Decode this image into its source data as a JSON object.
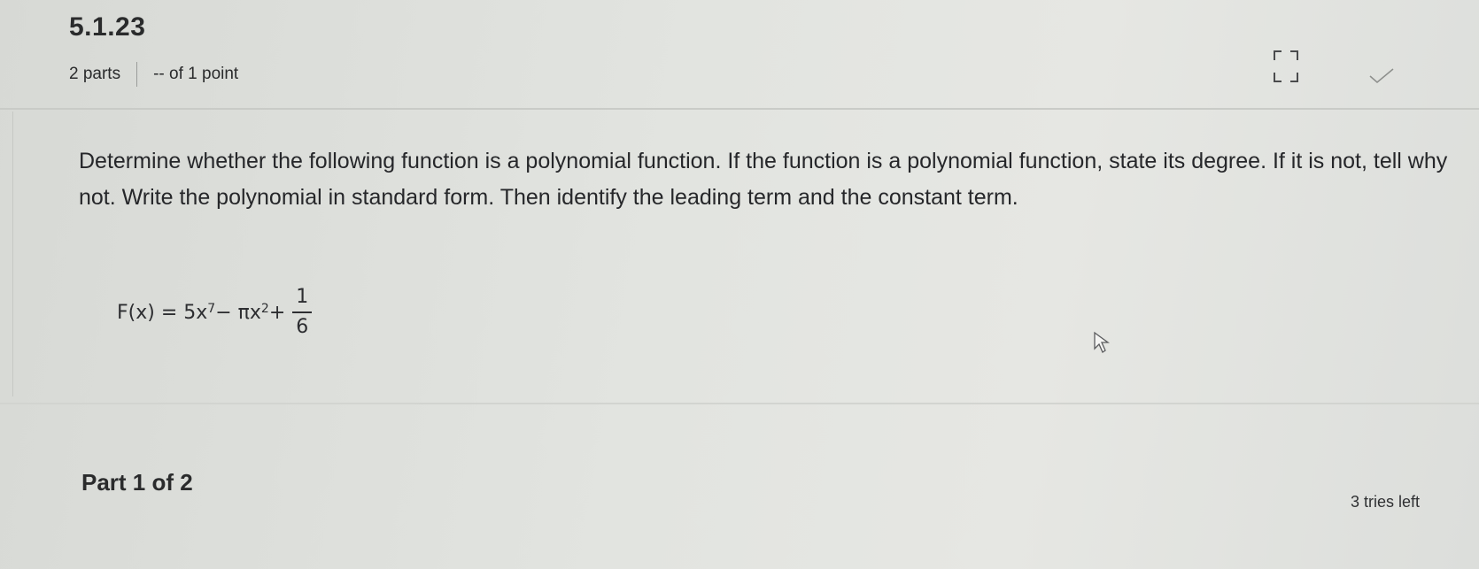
{
  "problem": {
    "number": "5.1.23",
    "parts": "2 parts",
    "points": "-- of 1 point"
  },
  "question": {
    "text": "Determine whether the following function is a polynomial function. If the function is a polynomial function, state its degree. If it is not, tell why not. Write the polynomial in standard form. Then identify the leading term and the constant term."
  },
  "formula": {
    "lhs": "F(x) = 5x",
    "exp1": "7",
    "mid": " − πx",
    "exp2": "2",
    "plus": " +",
    "numerator": "1",
    "denominator": "6"
  },
  "part": {
    "label": "Part 1 of 2",
    "tries": "3 tries left"
  },
  "icons": {
    "expand": "expand-icon",
    "check": "check-icon",
    "cursor": "mouse-cursor-icon"
  }
}
